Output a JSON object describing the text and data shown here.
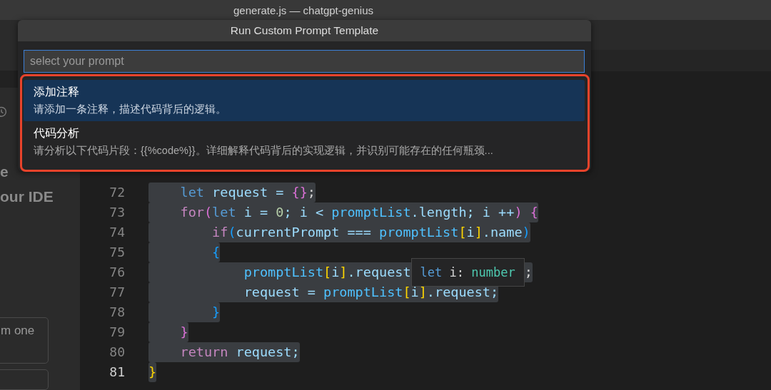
{
  "window": {
    "title": "generate.js — chatgpt-genius"
  },
  "sidebar": {
    "texts": [
      {
        "text": "e",
        "kind": "heading"
      },
      {
        "text": "our IDE",
        "kind": "heading"
      },
      {
        "text": "m one",
        "kind": "card"
      }
    ]
  },
  "editor": {
    "lines": [
      {
        "number": "72",
        "current": false,
        "tokens": [
          {
            "text": "    let ",
            "kind": "keyword"
          },
          {
            "text": "request = ",
            "kind": "var"
          },
          {
            "text": "{}",
            "kind": "b2"
          },
          {
            "text": ";",
            "kind": "plain"
          }
        ]
      },
      {
        "number": "73",
        "current": false,
        "tokens": [
          {
            "text": "    for",
            "kind": "control"
          },
          {
            "text": "(",
            "kind": "b2"
          },
          {
            "text": "let ",
            "kind": "keyword"
          },
          {
            "text": "i = ",
            "kind": "var"
          },
          {
            "text": "0",
            "kind": "number"
          },
          {
            "text": "; i < ",
            "kind": "var"
          },
          {
            "text": "promptList",
            "kind": "const"
          },
          {
            "text": ".length; i ++",
            "kind": "var"
          },
          {
            "text": ")",
            "kind": "b2"
          },
          {
            "text": " {",
            "kind": "b2"
          }
        ]
      },
      {
        "number": "74",
        "current": false,
        "tokens": [
          {
            "text": "        if",
            "kind": "control"
          },
          {
            "text": "(",
            "kind": "b3"
          },
          {
            "text": "currentPrompt === ",
            "kind": "var"
          },
          {
            "text": "promptList",
            "kind": "const"
          },
          {
            "text": "[",
            "kind": "b1"
          },
          {
            "text": "i",
            "kind": "var"
          },
          {
            "text": "]",
            "kind": "b1"
          },
          {
            "text": ".name",
            "kind": "var"
          },
          {
            "text": ")",
            "kind": "b3"
          }
        ]
      },
      {
        "number": "75",
        "current": false,
        "tokens": [
          {
            "text": "        {",
            "kind": "b3"
          }
        ]
      },
      {
        "number": "76",
        "current": false,
        "tokens": [
          {
            "text": "            promptList",
            "kind": "const"
          },
          {
            "text": "[",
            "kind": "b1"
          },
          {
            "text": "i",
            "kind": "var"
          },
          {
            "text": "]",
            "kind": "b1"
          },
          {
            "text": ".request",
            "kind": "var"
          },
          {
            "text": "let i: number",
            "kind": "hover"
          },
          {
            "text": ";",
            "kind": "plain"
          }
        ]
      },
      {
        "number": "77",
        "current": false,
        "tokens": [
          {
            "text": "            request = ",
            "kind": "var"
          },
          {
            "text": "promptList",
            "kind": "const"
          },
          {
            "text": "[",
            "kind": "b1"
          },
          {
            "text": "i",
            "kind": "var"
          },
          {
            "text": "]",
            "kind": "b1"
          },
          {
            "text": ".request;",
            "kind": "var"
          }
        ]
      },
      {
        "number": "78",
        "current": false,
        "tokens": [
          {
            "text": "        }",
            "kind": "b3"
          }
        ]
      },
      {
        "number": "79",
        "current": false,
        "tokens": [
          {
            "text": "    }",
            "kind": "b2"
          }
        ]
      },
      {
        "number": "80",
        "current": false,
        "tokens": [
          {
            "text": "    return ",
            "kind": "control"
          },
          {
            "text": "request;",
            "kind": "var"
          }
        ]
      },
      {
        "number": "81",
        "current": true,
        "tokens": [
          {
            "text": "}",
            "kind": "b1"
          }
        ]
      }
    ]
  },
  "quick_pick": {
    "title": "Run Custom Prompt Template",
    "placeholder": "select your prompt",
    "highlighted": true,
    "items": [
      {
        "label": "添加注释",
        "description": "请添加一条注释，描述代码背后的逻辑。",
        "selected": true
      },
      {
        "label": "代码分析",
        "description": "请分析以下代码片段：{{%code%}}。详细解释代码背后的实现逻辑，并识别可能存在的任何瓶颈...",
        "selected": false
      }
    ]
  }
}
